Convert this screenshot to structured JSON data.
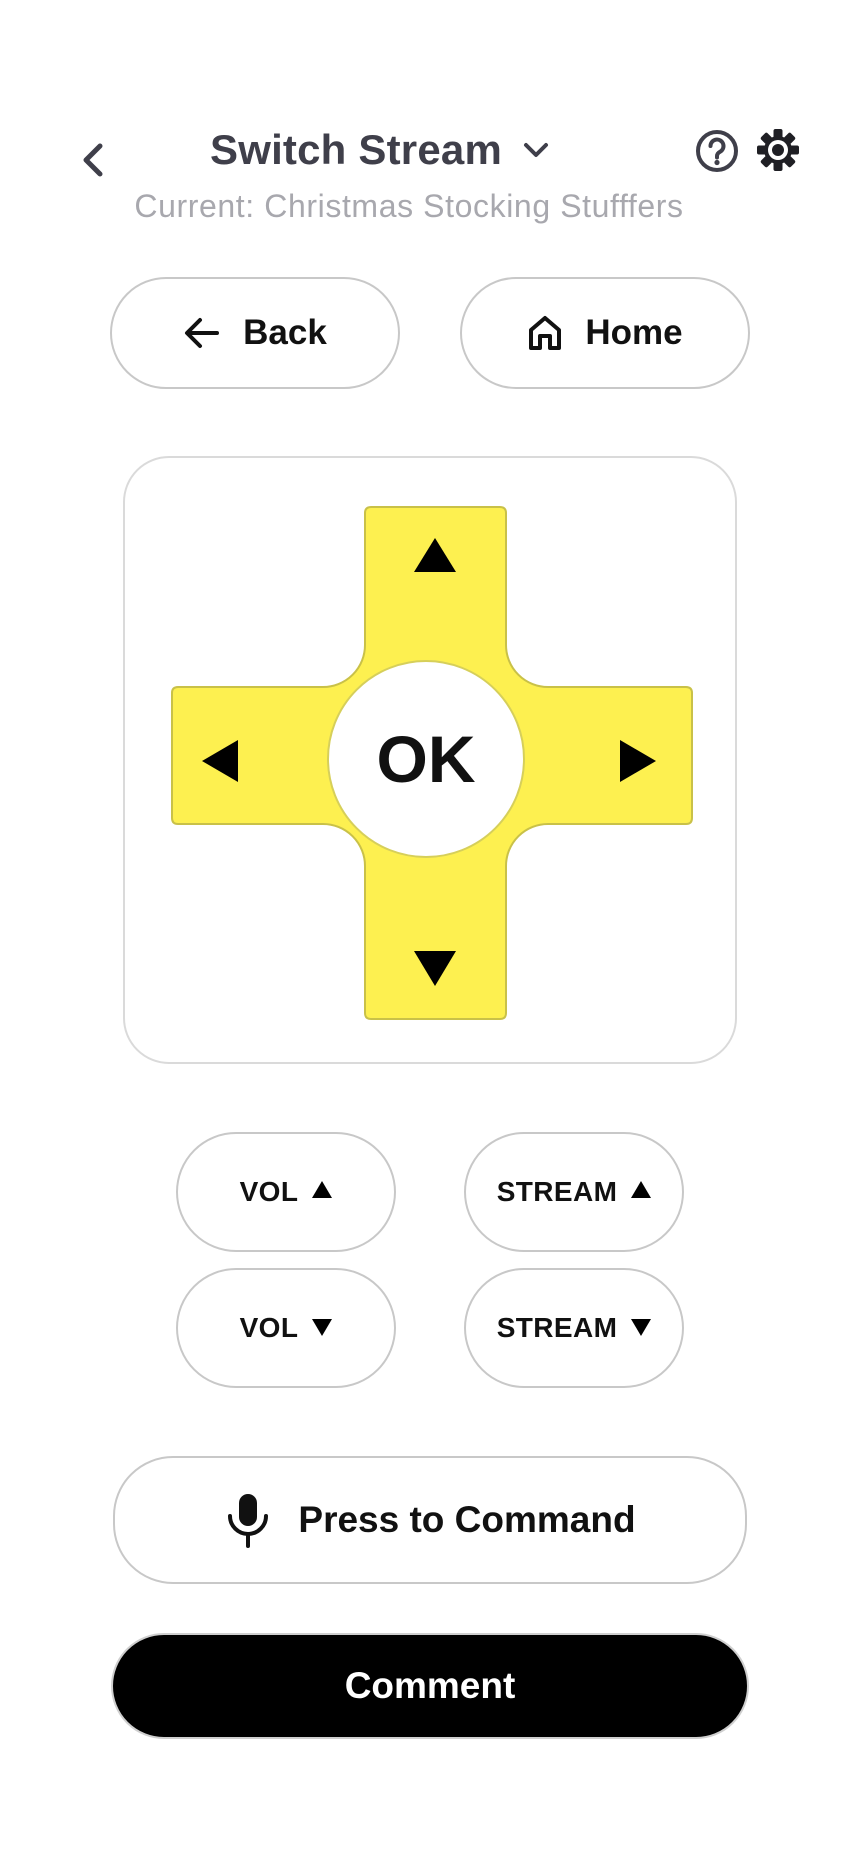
{
  "header": {
    "back_icon": "chevron-left-icon",
    "title": "Switch Stream",
    "title_icon": "chevron-down-icon",
    "subtitle": "Current: Christmas Stocking Stufffers",
    "help_icon": "help-circle-icon",
    "settings_icon": "gear-icon"
  },
  "nav": {
    "back_label": "Back",
    "back_icon": "arrow-left-icon",
    "home_label": "Home",
    "home_icon": "home-icon"
  },
  "dpad": {
    "ok_label": "OK",
    "color": "#fdf050",
    "up_icon": "triangle-up-icon",
    "down_icon": "triangle-down-icon",
    "left_icon": "triangle-left-icon",
    "right_icon": "triangle-right-icon"
  },
  "controls": {
    "vol_up_label": "VOL",
    "vol_down_label": "VOL",
    "stream_up_label": "STREAM",
    "stream_down_label": "STREAM"
  },
  "actions": {
    "command_label": "Press to Command",
    "command_icon": "microphone-icon",
    "comment_label": "Comment"
  },
  "colors": {
    "accent": "#fdf050",
    "title_text": "#3f3f4a",
    "subtitle_text": "#a8a8ae",
    "comment_bg": "#000000"
  }
}
